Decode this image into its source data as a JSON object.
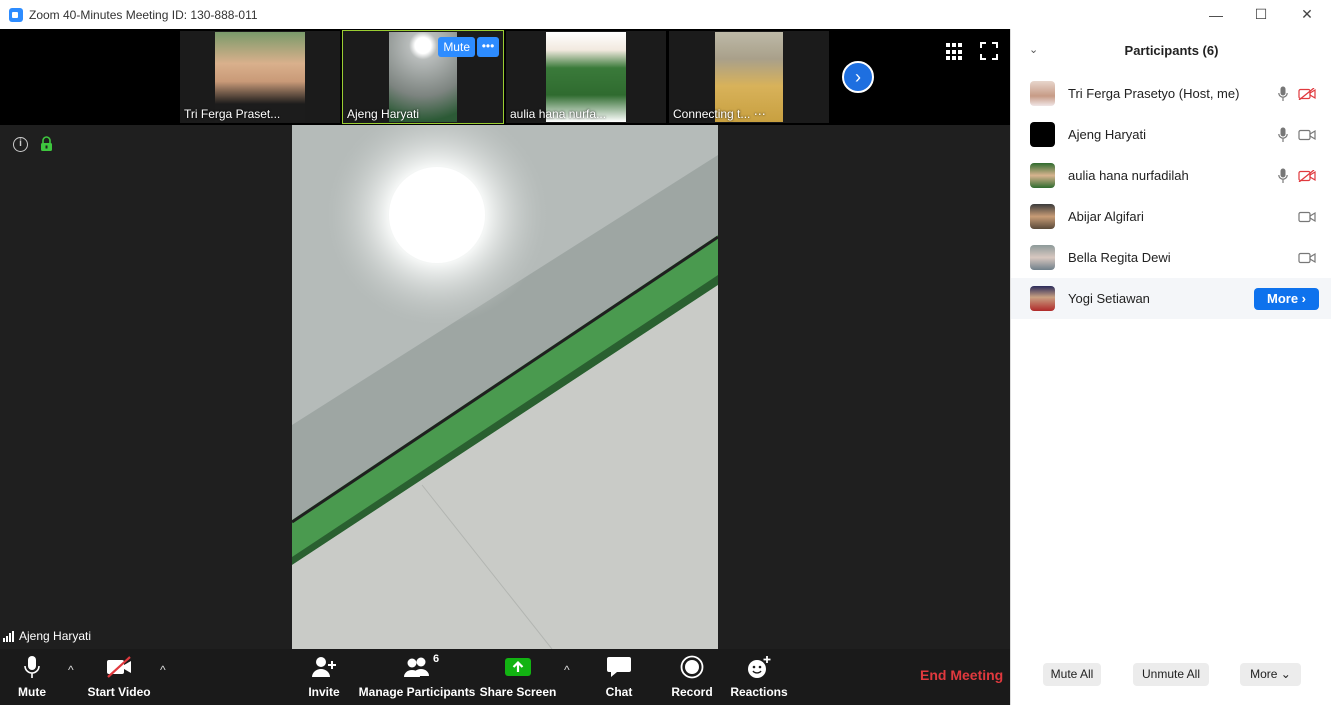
{
  "window": {
    "title": "Zoom 40-Minutes Meeting ID: 130-888-011",
    "minimize": "—",
    "maximize": "☐",
    "close": "✕"
  },
  "thumbnails": [
    {
      "name": "Tri Ferga Praset..."
    },
    {
      "name": "Ajeng Haryati",
      "mute_label": "Mute",
      "more_label": "•••"
    },
    {
      "name": "aulia hana nurfa..."
    },
    {
      "name": "Connecting t... ⋯"
    }
  ],
  "strip_next": "›",
  "main": {
    "info": "i",
    "speaker": "Ajeng Haryati"
  },
  "toolbar": {
    "mute": "Mute",
    "start_video": "Start Video",
    "invite": "Invite",
    "manage_participants": "Manage Participants",
    "participant_count": "6",
    "share_screen": "Share Screen",
    "chat": "Chat",
    "record": "Record",
    "reactions": "Reactions",
    "end_meeting": "End Meeting",
    "caret": "^"
  },
  "participants_panel": {
    "title": "Participants (6)",
    "collapse": "⌄",
    "participants": [
      {
        "name": "Tri Ferga Prasetyo (Host, me)",
        "mic": "on",
        "video": "off"
      },
      {
        "name": "Ajeng Haryati",
        "mic": "on",
        "video": "on"
      },
      {
        "name": "aulia hana nurfadilah",
        "mic": "on",
        "video": "off"
      },
      {
        "name": "Abijar Algifari",
        "mic": "none",
        "video": "on"
      },
      {
        "name": "Bella Regita Dewi",
        "mic": "none",
        "video": "on"
      },
      {
        "name": "Yogi Setiawan",
        "more_label": "More ›"
      }
    ],
    "footer": {
      "mute_all": "Mute All",
      "unmute_all": "Unmute All",
      "more": "More ⌄"
    }
  },
  "colors": {
    "accent_blue": "#2d8cff",
    "end_red": "#e0393e",
    "video_off_red": "#e0393e",
    "share_green": "#12b312"
  }
}
